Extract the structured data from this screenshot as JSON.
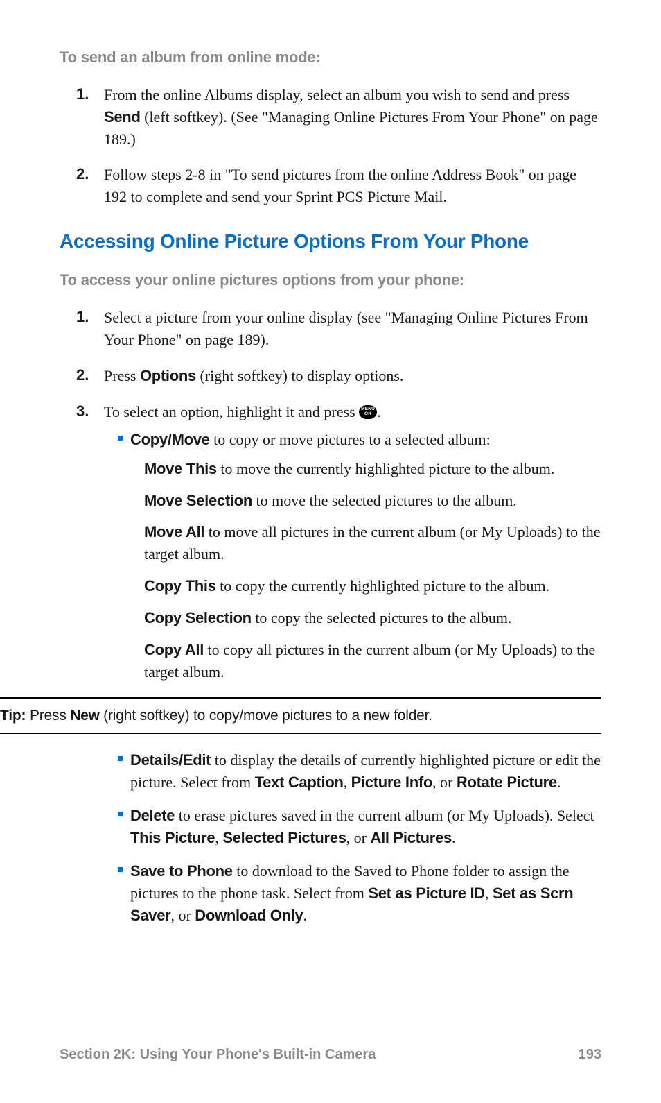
{
  "section1": {
    "subhead": "To send an album from online mode:",
    "steps": [
      {
        "num": "1.",
        "pre": "From the online Albums display, select an album you wish to send and press ",
        "bold": "Send",
        "post": " (left softkey). (See \"Managing Online Pictures From Your Phone\" on page 189.)"
      },
      {
        "num": "2.",
        "plain": "Follow steps 2-8 in \"To send pictures from the online Address Book\" on page 192 to complete and send your Sprint PCS Picture Mail."
      }
    ]
  },
  "title": "Accessing Online Picture Options From Your Phone",
  "section2": {
    "subhead": "To access your online pictures options from your phone:",
    "steps": [
      {
        "num": "1.",
        "plain": "Select a picture from your online display (see \"Managing Online Pictures From Your Phone\" on page 189)."
      },
      {
        "num": "2.",
        "pre": "Press ",
        "bold": "Options",
        "post": " (right softkey) to display options."
      },
      {
        "num": "3.",
        "preKey": "To select an option, highlight it and press ",
        "keyTop": "MENU",
        "keyBot": "OK",
        "postKey": "."
      }
    ]
  },
  "copyMove": {
    "bold": "Copy/Move",
    "text": " to copy or move pictures to a selected album:",
    "subs": [
      {
        "bold": "Move This",
        "text": " to move the currently highlighted picture to the album."
      },
      {
        "bold": "Move Selection",
        "text": " to move the selected pictures to the album."
      },
      {
        "bold": "Move All",
        "text": " to move all pictures in the current album (or My Uploads) to the target album."
      },
      {
        "bold": "Copy This",
        "text": " to copy the currently highlighted picture to the album."
      },
      {
        "bold": "Copy Selection",
        "text": " to copy the selected pictures to the album."
      },
      {
        "bold": "Copy All",
        "text": " to copy all pictures in the current album (or My Uploads) to the target album."
      }
    ]
  },
  "tip": {
    "label": "Tip:",
    "pre": " Press ",
    "bold": "New",
    "post": " (right softkey) to copy/move pictures to a new folder."
  },
  "details": {
    "bold": "Details/Edit",
    "text1": " to display the details of currently highlighted picture or edit the picture. Select from ",
    "b1": "Text Caption",
    "c1": ", ",
    "b2": "Picture Info",
    "c2": ", or ",
    "b3": "Rotate Picture",
    "c3": "."
  },
  "delete": {
    "bold": "Delete",
    "text1": " to erase pictures saved in the current album (or My Uploads). Select ",
    "b1": "This Picture",
    "c1": ", ",
    "b2": "Selected Pictures",
    "c2": ", or ",
    "b3": "All Pictures",
    "c3": "."
  },
  "save": {
    "bold": "Save to Phone",
    "text1": " to download to the Saved to Phone folder to assign the pictures to the phone task. Select from ",
    "b1": "Set as Picture ID",
    "c1": ", ",
    "b2": "Set as Scrn Saver",
    "c2": ", or ",
    "b3": "Download Only",
    "c3": "."
  },
  "footer": {
    "section": "Section 2K: Using Your Phone's Built-in Camera",
    "page": "193"
  }
}
